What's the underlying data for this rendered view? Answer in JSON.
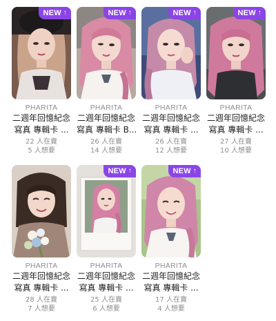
{
  "badge": {
    "label": "NEW",
    "icon": "arrow-up-icon",
    "color": "#8b45e6"
  },
  "items": [
    {
      "brand": "PHARITA",
      "title_line1": "二週年回憶紀念",
      "title_line2": "寫真 專輯卡 ...",
      "sellers": "22 人在賣",
      "wanters": "5 人想要"
    },
    {
      "brand": "PHARITA",
      "title_line1": "二週年回憶紀念",
      "title_line2": "寫真 專輯卡 B...",
      "sellers": "26 人在賣",
      "wanters": "14 人想要"
    },
    {
      "brand": "PHARITA",
      "title_line1": "二週年回憶紀念",
      "title_line2": "寫真 專輯卡 ...",
      "sellers": "26 人在賣",
      "wanters": "12 人想要"
    },
    {
      "brand": "PHARITA",
      "title_line1": "二週年回憶紀念",
      "title_line2": "寫真 專輯卡 ...",
      "sellers": "27 人在賣",
      "wanters": "10 人想要"
    },
    {
      "brand": "PHARITA",
      "title_line1": "二週年回憶紀念",
      "title_line2": "寫真 專輯卡 ...",
      "sellers": "28 人在賣",
      "wanters": "7 人想要"
    },
    {
      "brand": "PHARITA",
      "title_line1": "二週年回憶紀念",
      "title_line2": "寫真 專輯卡 ...",
      "sellers": "25 人在賣",
      "wanters": "6 人想要"
    },
    {
      "brand": "PHARITA",
      "title_line1": "二週年回憶紀念",
      "title_line2": "寫真 專輯卡 ...",
      "sellers": "17 人在賣",
      "wanters": "4 人想要"
    }
  ]
}
